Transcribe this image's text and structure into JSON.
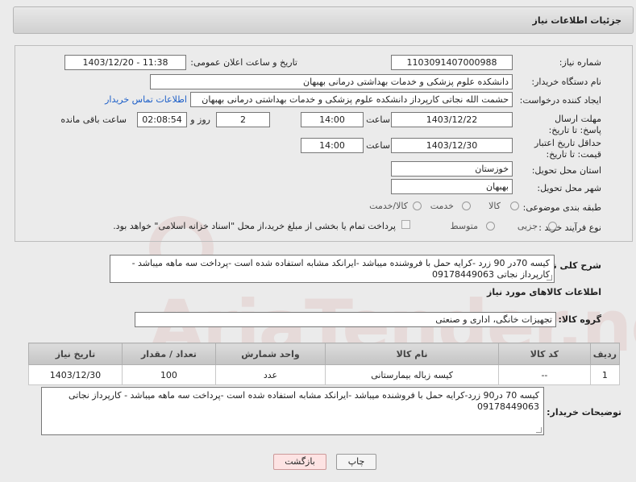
{
  "header": {
    "title": "جزئیات اطلاعات نیاز"
  },
  "fields": {
    "need_number_label": "شماره نیاز:",
    "need_number": "1103091407000988",
    "announce_label": "تاریخ و ساعت اعلان عمومی:",
    "announce_value": "1403/12/20 - 11:38",
    "buyer_org_label": "نام دستگاه خریدار:",
    "buyer_org": "دانشکده علوم پزشکی و خدمات بهداشتی درمانی بهبهان",
    "creator_label": "ایجاد کننده درخواست:",
    "creator": "حشمت الله نجاتی کارپرداز دانشکده علوم پزشکی و خدمات بهداشتی درمانی بهبهان",
    "contact_link": "اطلاعات تماس خریدار",
    "deadline_label": "مهلت ارسال پاسخ: تا تاریخ:",
    "deadline_date": "1403/12/22",
    "time_label": "ساعت",
    "deadline_time": "14:00",
    "days_value": "2",
    "days_label": "روز و",
    "remaining_time": "02:08:54",
    "remaining_label": "ساعت باقی مانده",
    "validity_label": "حداقل تاریخ اعتبار قیمت: تا تاریخ:",
    "validity_date": "1403/12/30",
    "validity_time": "14:00",
    "province_label": "استان محل تحویل:",
    "province": "خوزستان",
    "city_label": "شهر محل تحویل:",
    "city": "بهبهان",
    "category_label": "طبقه بندی موضوعی:",
    "category_options": [
      "کالا",
      "خدمت",
      "کالا/خدمت"
    ],
    "process_label": "نوع فرآیند خرید :",
    "process_options": [
      "جزیی",
      "متوسط"
    ],
    "payment_note": "پرداخت تمام یا بخشی از مبلغ خرید،از محل \"اسناد خزانه اسلامی\" خواهد بود."
  },
  "general_desc": {
    "label": "شرح کلی نیاز:",
    "text": "کیسه 70در 90 زرد -کرایه حمل با فروشنده میباشد -ایرانکد مشابه استفاده شده است -پرداخت سه ماهه میباشد - کارپرداز نجاتی 09178449063"
  },
  "goods": {
    "section_title": "اطلاعات کالاهای مورد نیاز",
    "group_label": "گروه کالا:",
    "group_value": "تجهیزات خانگی، اداری و صنعتی",
    "columns": [
      "ردیف",
      "کد کالا",
      "نام کالا",
      "واحد شمارش",
      "تعداد / مقدار",
      "تاریخ نیاز"
    ],
    "rows": [
      {
        "index": "1",
        "code": "--",
        "name": "کیسه زباله بیمارستانی",
        "unit": "عدد",
        "qty": "100",
        "date": "1403/12/30"
      }
    ]
  },
  "buyer_desc": {
    "label": "توضیحات خریدار:",
    "text": "کیسه 70 در90 زرد-کرایه حمل با فروشنده میباشد -ایرانکد مشابه استفاده شده است -پرداخت سه ماهه میباشد - کارپرداز نجاتی 09178449063"
  },
  "buttons": {
    "print": "چاپ",
    "back": "بازگشت"
  },
  "colors": {
    "accent_link": "#1b5ec8",
    "back_button_bg": "#fde3e3",
    "print_button_bg": "#f4f4f4"
  }
}
